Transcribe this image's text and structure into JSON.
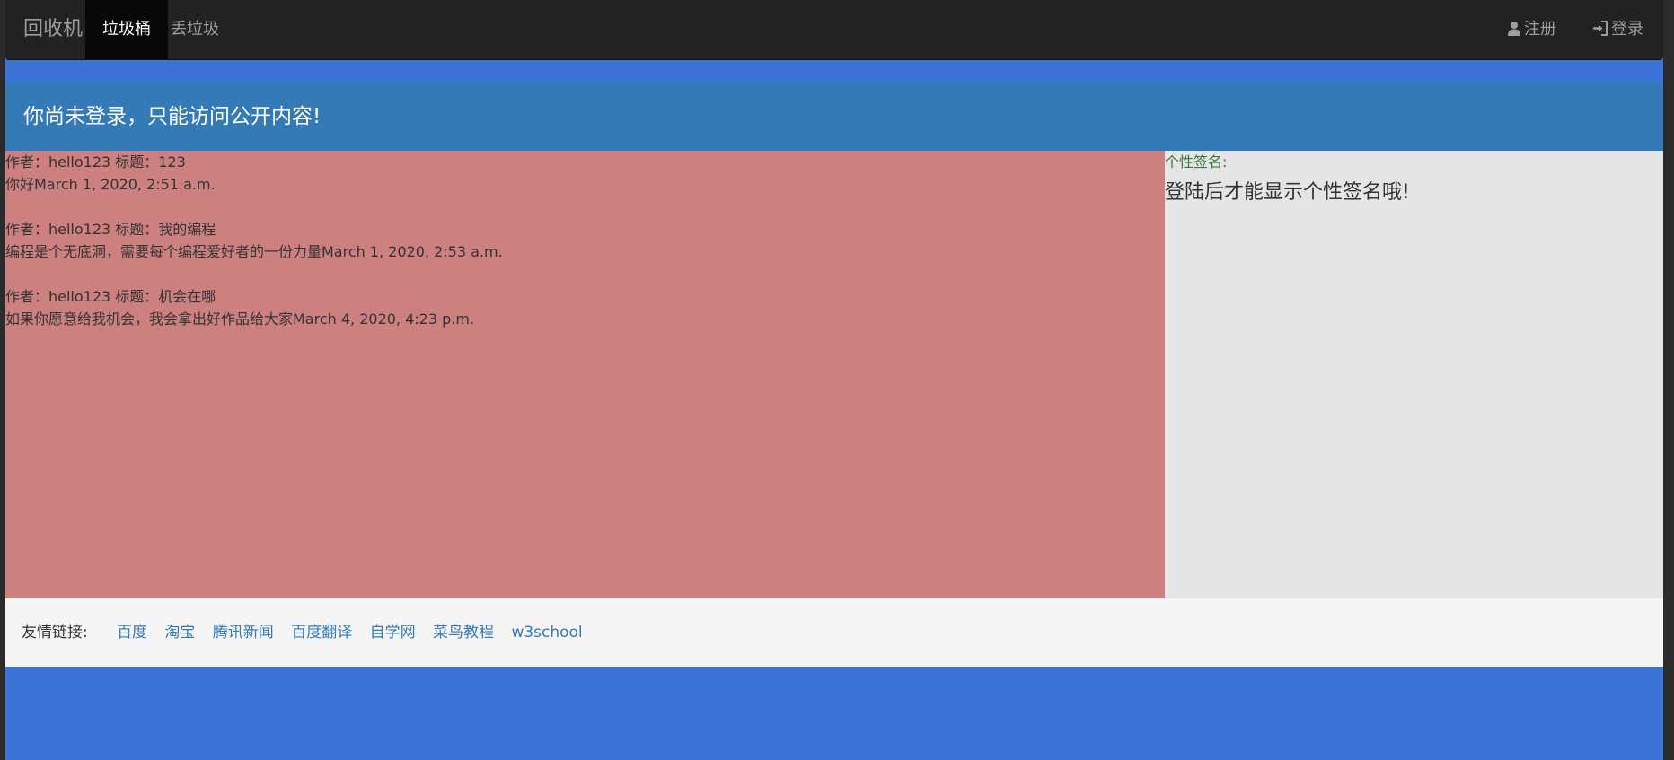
{
  "navbar": {
    "brand": "回收机",
    "tabs": [
      {
        "label": "垃圾桶",
        "active": true
      },
      {
        "label": "丢垃圾",
        "active": false
      }
    ],
    "register_label": "注册",
    "login_label": "登录"
  },
  "notice": {
    "text": "你尚未登录，只能访问公开内容!"
  },
  "posts": [
    {
      "meta": "作者：hello123  标题：123",
      "body": "你好March 1, 2020, 2:51 a.m."
    },
    {
      "meta": "作者：hello123  标题：我的编程",
      "body": "编程是个无底洞，需要每个编程爱好者的一份力量March 1, 2020, 2:53 a.m."
    },
    {
      "meta": "作者：hello123  标题：机会在哪",
      "body": "如果你愿意给我机会，我会拿出好作品给大家March 4, 2020, 4:23 p.m."
    }
  ],
  "sidebar": {
    "signature_label": "个性签名:",
    "signature_text": "登陆后才能显示个性签名哦!"
  },
  "footer": {
    "label": "友情链接:",
    "links": [
      "百度",
      "淘宝",
      "腾讯新闻",
      "百度翻译",
      "自学网",
      "菜鸟教程",
      "w3school"
    ]
  },
  "colors": {
    "navbar_bg": "#222222",
    "page_bg": "#3b74d6",
    "notice_bg": "#337ab7",
    "posts_bg": "#cd8080",
    "sidebar_bg": "#e5e5e5",
    "footer_bg": "#f5f5f5",
    "link": "#337ab7",
    "signature_label": "#3c763d"
  },
  "icons": {
    "register": "user-icon",
    "login": "sign-in-icon"
  }
}
